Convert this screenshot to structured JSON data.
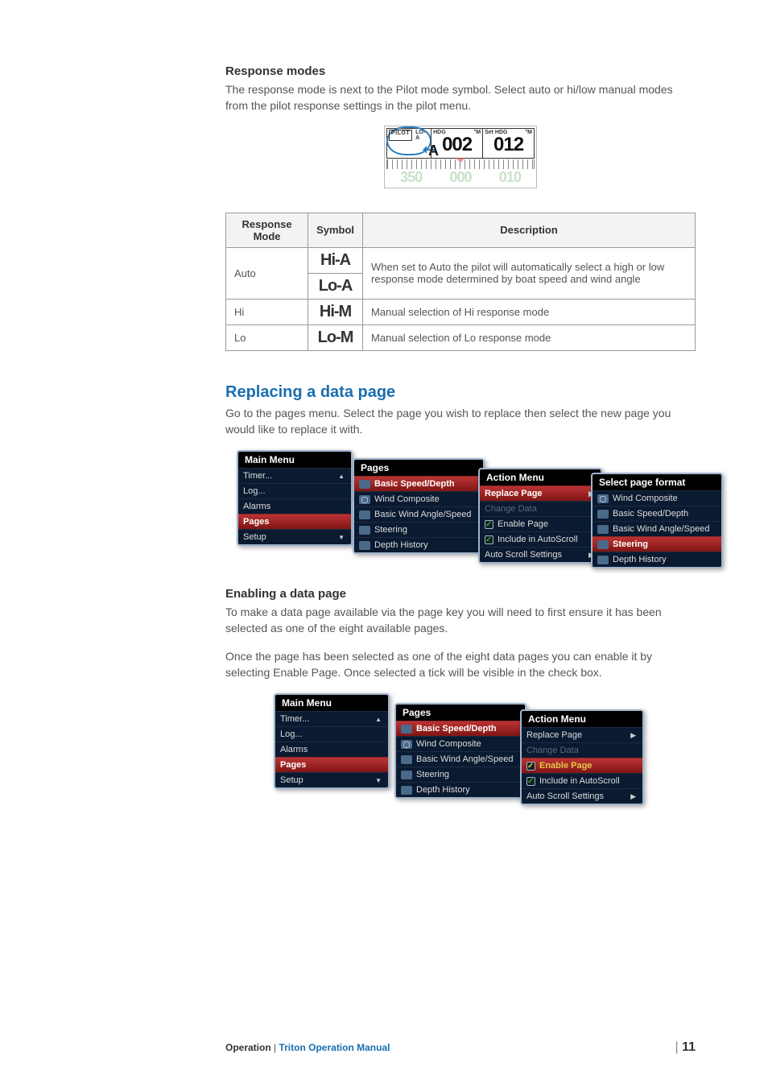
{
  "response_modes": {
    "heading": "Response modes",
    "para": "The response mode is next to the Pilot mode symbol. Select auto or hi/low manual modes from the pilot response settings in the pilot menu."
  },
  "pilot_display": {
    "pilot_badge": "PILOT",
    "loa_small": "LO-A",
    "hdg_label_left": "HDG",
    "hdg_label_right": "°M",
    "set_label": "Set HDG",
    "set_unit": "°M",
    "a_letter": "A",
    "hdg_value": "002",
    "set_value": "012",
    "bottom1": "350",
    "bottom2": "000",
    "bottom3": "010"
  },
  "table": {
    "headers": [
      "Response Mode",
      "Symbol",
      "Description"
    ],
    "rows": [
      {
        "mode": "Auto",
        "sym1": "Hi-A",
        "sym2": "Lo-A",
        "desc": "When set to Auto the pilot will automatically select a high or low response mode determined by boat speed and wind angle"
      },
      {
        "mode": "Hi",
        "sym": "Hi-M",
        "desc": "Manual selection of Hi response mode"
      },
      {
        "mode": "Lo",
        "sym": "Lo-M",
        "desc": "Manual selection of Lo response mode"
      }
    ]
  },
  "replace": {
    "heading": "Replacing a data page",
    "para": "Go to the pages menu. Select the page you wish to replace then select the new page you would like to replace it with."
  },
  "menu1": {
    "main_title": "Main Menu",
    "main_items": [
      "Timer...",
      "Log...",
      "Alarms",
      "Pages",
      "Setup"
    ],
    "pages_title": "Pages",
    "pages_items": [
      "Basic Speed/Depth",
      "Wind Composite",
      "Basic Wind Angle/Speed",
      "Steering",
      "Depth History"
    ],
    "action_title": "Action Menu",
    "action_items": [
      "Replace Page",
      "Change Data",
      "Enable Page",
      "Include in AutoScroll",
      "Auto Scroll Settings"
    ],
    "format_title": "Select page format",
    "format_items": [
      "Wind Composite",
      "Basic Speed/Depth",
      "Basic Wind Angle/Speed",
      "Steering",
      "Depth History"
    ]
  },
  "enable": {
    "heading": "Enabling a data page",
    "para1": "To make a data page available via the page key you will need to first ensure it has been selected as one of the eight available pages.",
    "para2": "Once the page has been selected as one of the eight data pages you can enable it by selecting Enable Page. Once selected a tick will be visible in the check box."
  },
  "menu2": {
    "main_title": "Main Menu",
    "main_items": [
      "Timer...",
      "Log...",
      "Alarms",
      "Pages",
      "Setup"
    ],
    "pages_title": "Pages",
    "pages_items": [
      "Basic Speed/Depth",
      "Wind Composite",
      "Basic Wind Angle/Speed",
      "Steering",
      "Depth History"
    ],
    "action_title": "Action Menu",
    "action_items": [
      "Replace Page",
      "Change Data",
      "Enable Page",
      "Include in AutoScroll",
      "Auto Scroll Settings"
    ]
  },
  "footer": {
    "oper": "Operation",
    "sep": " | ",
    "manual": "Triton Operation Manual",
    "page_bar": "| ",
    "page_num": "11"
  }
}
